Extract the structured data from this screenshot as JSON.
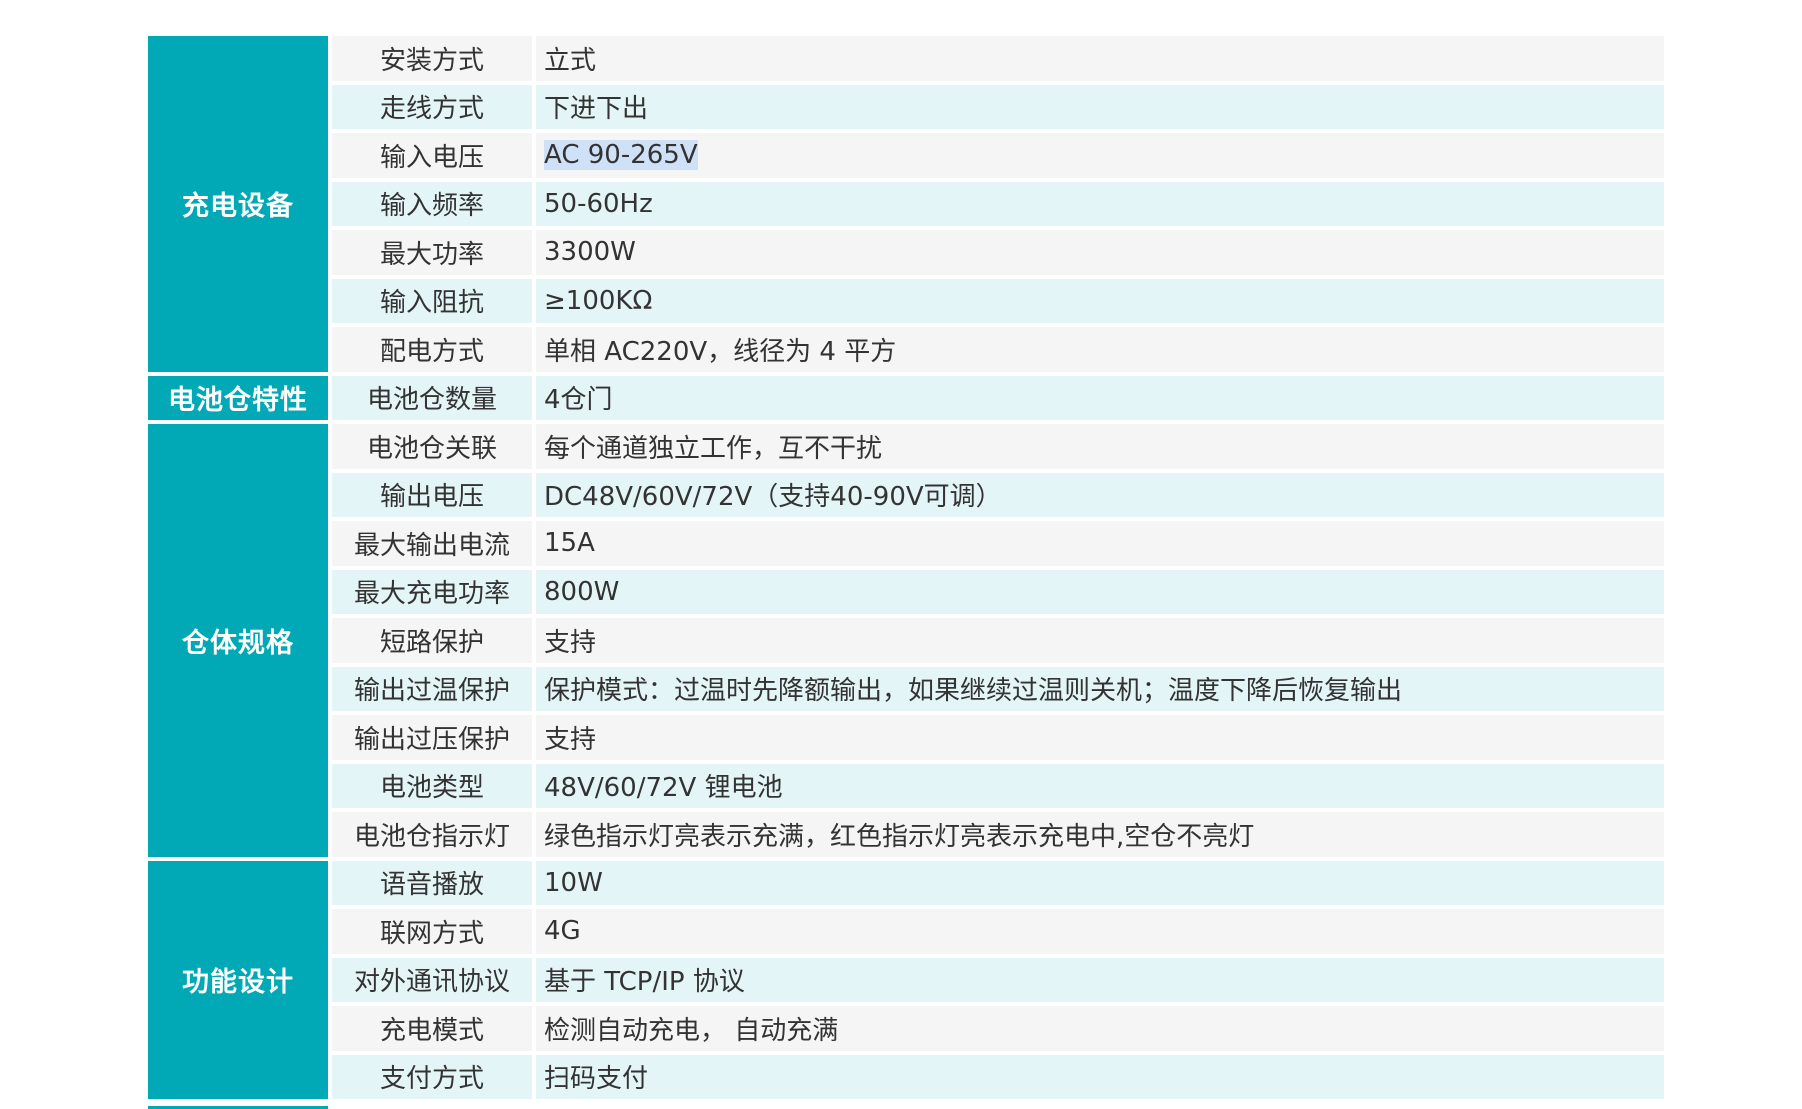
{
  "groups": [
    {
      "name": "充电设备",
      "rows": [
        {
          "label": "安装方式",
          "value": "立式"
        },
        {
          "label": "走线方式",
          "value": "下进下出"
        },
        {
          "label": "输入电压",
          "value": "AC 90-265V",
          "highlight": true
        },
        {
          "label": "输入频率",
          "value": "50-60Hz"
        },
        {
          "label": "最大功率",
          "value": "3300W"
        },
        {
          "label": "输入阻抗",
          "value": "≥100KΩ"
        },
        {
          "label": "配电方式",
          "value": "单相 AC220V，线径为 4 平方"
        }
      ]
    },
    {
      "name": "电池仓特性",
      "rows": [
        {
          "label": "电池仓数量",
          "value": "4仓门"
        }
      ]
    },
    {
      "name": "仓体规格",
      "rows": [
        {
          "label": "电池仓关联",
          "value": "每个通道独立工作，互不干扰"
        },
        {
          "label": "输出电压",
          "value": "DC48V/60V/72V（支持40-90V可调）"
        },
        {
          "label": "最大输出电流",
          "value": "15A"
        },
        {
          "label": "最大充电功率",
          "value": "800W"
        },
        {
          "label": "短路保护",
          "value": "支持"
        },
        {
          "label": "输出过温保护",
          "value": "保护模式：过温时先降额输出，如果继续过温则关机；温度下降后恢复输出"
        },
        {
          "label": "输出过压保护",
          "value": "支持"
        },
        {
          "label": "电池类型",
          "value": "48V/60/72V 锂电池"
        },
        {
          "label": "电池仓指示灯",
          "value": "绿色指示灯亮表示充满，红色指示灯亮表示充电中,空仓不亮灯"
        }
      ]
    },
    {
      "name": "功能设计",
      "rows": [
        {
          "label": "语音播放",
          "value": "10W"
        },
        {
          "label": "联网方式",
          "value": "4G"
        },
        {
          "label": "对外通讯协议",
          "value": "基于 TCP/IP 协议"
        },
        {
          "label": "充电模式",
          "value": "检测自动充电， 自动充满"
        },
        {
          "label": "支付方式",
          "value": "扫码支付"
        }
      ]
    }
  ],
  "colors": {
    "category": "#00a9b5",
    "row_odd": "#f5f5f5",
    "row_even": "#e4f5f8",
    "selection": "#cfe1f6"
  }
}
